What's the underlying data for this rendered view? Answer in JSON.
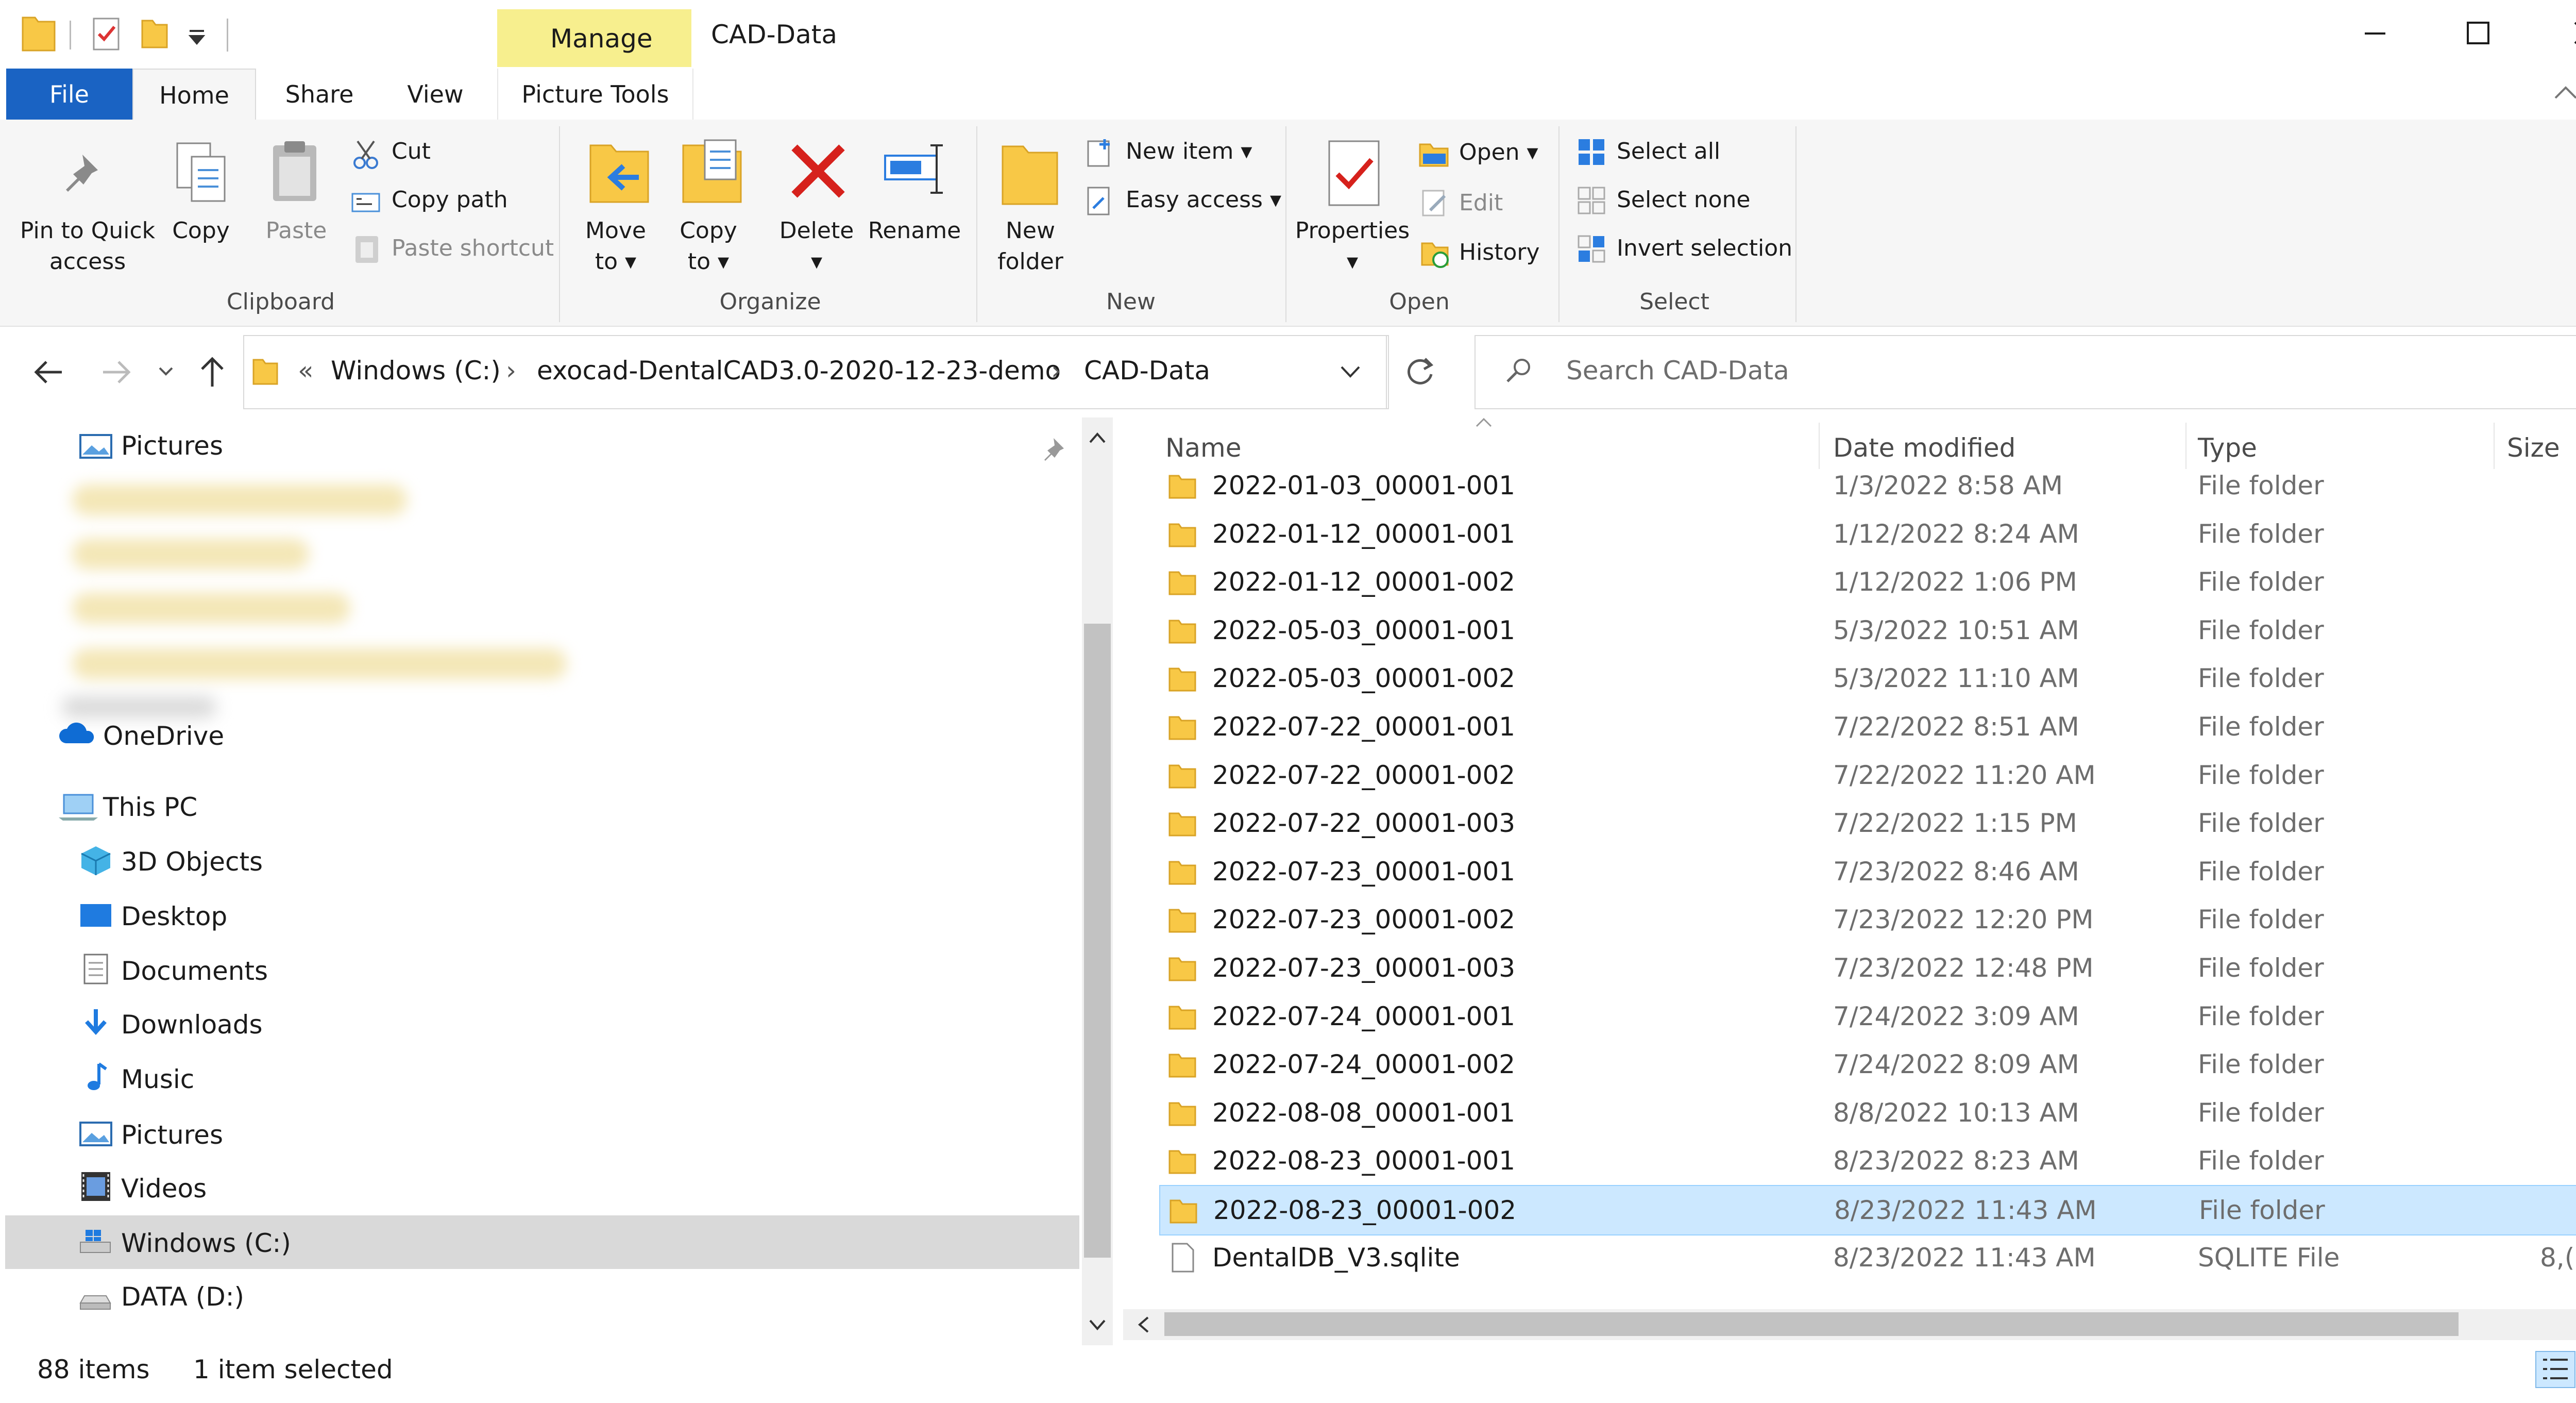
{
  "window": {
    "title": "CAD-Data",
    "manage_tab": "Manage",
    "picture_tools_tab": "Picture Tools"
  },
  "tabs": [
    {
      "label": "File"
    },
    {
      "label": "Home"
    },
    {
      "label": "Share"
    },
    {
      "label": "View"
    }
  ],
  "ribbon": {
    "clipboard": {
      "group_label": "Clipboard",
      "pin_label": "Pin to Quick access",
      "pin_line1": "Pin to Quick",
      "pin_line2": "access",
      "copy_label": "Copy",
      "paste_label": "Paste",
      "cut_label": "Cut",
      "copy_path_label": "Copy path",
      "paste_shortcut_label": "Paste shortcut"
    },
    "organize": {
      "group_label": "Organize",
      "move_to_line1": "Move",
      "move_to_line2": "to",
      "copy_to_line1": "Copy",
      "copy_to_line2": "to",
      "delete_label": "Delete",
      "rename_label": "Rename"
    },
    "new": {
      "group_label": "New",
      "new_folder_line1": "New",
      "new_folder_line2": "folder",
      "new_item_label": "New item",
      "easy_access_label": "Easy access"
    },
    "open": {
      "group_label": "Open",
      "properties_label": "Properties",
      "open_label": "Open",
      "edit_label": "Edit",
      "history_label": "History"
    },
    "select": {
      "group_label": "Select",
      "select_all_label": "Select all",
      "select_none_label": "Select none",
      "invert_selection_label": "Invert selection"
    }
  },
  "address": {
    "overflow": "«",
    "crumbs": [
      "Windows (C:)",
      "exocad-DentalCAD3.0-2020-12-23-demo",
      "CAD-Data"
    ],
    "search_placeholder": "Search CAD-Data"
  },
  "nav": {
    "pictures_quick": "Pictures",
    "onedrive": "OneDrive",
    "this_pc": "This PC",
    "objects3d": "3D Objects",
    "desktop": "Desktop",
    "documents": "Documents",
    "downloads": "Downloads",
    "music": "Music",
    "pictures": "Pictures",
    "videos": "Videos",
    "windows_c": "Windows (C:)",
    "data_d": "DATA (D:)"
  },
  "columns": {
    "name": "Name",
    "date_modified": "Date modified",
    "type": "Type",
    "size": "Size"
  },
  "files": [
    {
      "name": "2022-01-03_00001-001",
      "date": "1/3/2022 8:58 AM",
      "type": "File folder",
      "size": ""
    },
    {
      "name": "2022-01-12_00001-001",
      "date": "1/12/2022 8:24 AM",
      "type": "File folder",
      "size": ""
    },
    {
      "name": "2022-01-12_00001-002",
      "date": "1/12/2022 1:06 PM",
      "type": "File folder",
      "size": ""
    },
    {
      "name": "2022-05-03_00001-001",
      "date": "5/3/2022 10:51 AM",
      "type": "File folder",
      "size": ""
    },
    {
      "name": "2022-05-03_00001-002",
      "date": "5/3/2022 11:10 AM",
      "type": "File folder",
      "size": ""
    },
    {
      "name": "2022-07-22_00001-001",
      "date": "7/22/2022 8:51 AM",
      "type": "File folder",
      "size": ""
    },
    {
      "name": "2022-07-22_00001-002",
      "date": "7/22/2022 11:20 AM",
      "type": "File folder",
      "size": ""
    },
    {
      "name": "2022-07-22_00001-003",
      "date": "7/22/2022 1:15 PM",
      "type": "File folder",
      "size": ""
    },
    {
      "name": "2022-07-23_00001-001",
      "date": "7/23/2022 8:46 AM",
      "type": "File folder",
      "size": ""
    },
    {
      "name": "2022-07-23_00001-002",
      "date": "7/23/2022 12:20 PM",
      "type": "File folder",
      "size": ""
    },
    {
      "name": "2022-07-23_00001-003",
      "date": "7/23/2022 12:48 PM",
      "type": "File folder",
      "size": ""
    },
    {
      "name": "2022-07-24_00001-001",
      "date": "7/24/2022 3:09 AM",
      "type": "File folder",
      "size": ""
    },
    {
      "name": "2022-07-24_00001-002",
      "date": "7/24/2022 8:09 AM",
      "type": "File folder",
      "size": ""
    },
    {
      "name": "2022-08-08_00001-001",
      "date": "8/8/2022 10:13 AM",
      "type": "File folder",
      "size": ""
    },
    {
      "name": "2022-08-23_00001-001",
      "date": "8/23/2022 8:23 AM",
      "type": "File folder",
      "size": ""
    },
    {
      "name": "2022-08-23_00001-002",
      "date": "8/23/2022 11:43 AM",
      "type": "File folder",
      "size": "",
      "selected": true
    },
    {
      "name": "DentalDB_V3.sqlite",
      "date": "8/23/2022 11:43 AM",
      "type": "SQLITE File",
      "size": "8,("
    }
  ],
  "status": {
    "item_count": "88 items",
    "selection": "1 item selected"
  },
  "colors": {
    "file_tab": "#1a63c3",
    "manage_tab": "#f7ef8e",
    "selection": "#cce8ff",
    "folder": "#f8c846"
  }
}
